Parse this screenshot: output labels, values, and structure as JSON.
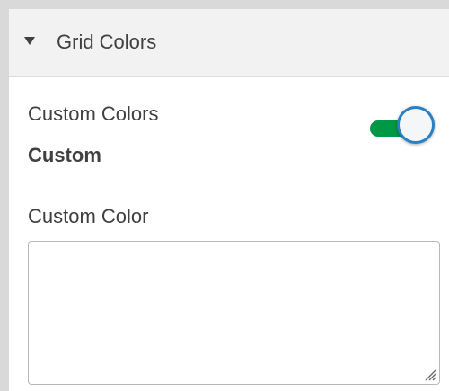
{
  "section": {
    "title": "Grid Colors",
    "expanded": true,
    "caret_icon": "caret-down-icon"
  },
  "custom_colors": {
    "label": "Custom Colors",
    "value": "Custom",
    "toggle_on": true,
    "toggle_track_color": "#009845",
    "toggle_knob_border_color": "#2b7fc3"
  },
  "custom_color": {
    "label": "Custom Color",
    "value": "",
    "placeholder": ""
  },
  "colors": {
    "header_bg": "#f2f2f2",
    "text": "#404040",
    "frame": "#d9d9d9"
  }
}
